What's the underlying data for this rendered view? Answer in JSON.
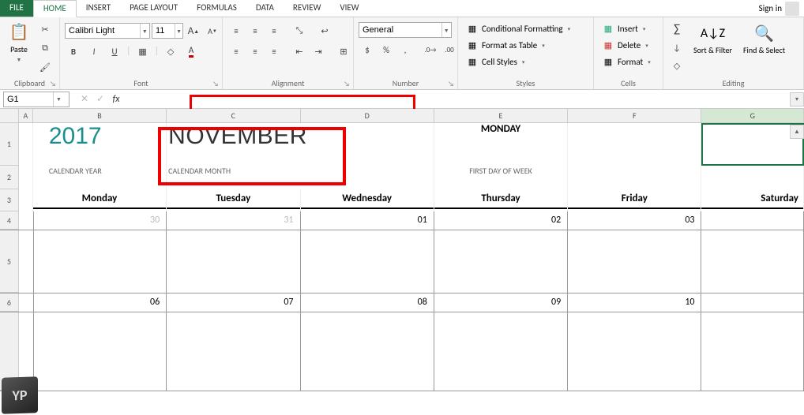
{
  "tabs": {
    "file": "FILE",
    "home": "HOME",
    "insert": "INSERT",
    "pagelayout": "PAGE LAYOUT",
    "formulas": "FORMULAS",
    "data": "DATA",
    "review": "REVIEW",
    "view": "VIEW"
  },
  "signin": "Sign in",
  "ribbon": {
    "clipboard": {
      "label": "Clipboard",
      "paste": "Paste"
    },
    "font": {
      "label": "Font",
      "name": "Calibri Light",
      "size": "11"
    },
    "alignment": {
      "label": "Alignment"
    },
    "number": {
      "label": "Number",
      "format": "General"
    },
    "styles": {
      "label": "Styles",
      "cond": "Conditional Formatting",
      "table": "Format as Table",
      "cellstyles": "Cell Styles"
    },
    "cells": {
      "label": "Cells",
      "insert": "Insert",
      "delete": "Delete",
      "format": "Format"
    },
    "editing": {
      "label": "Editing",
      "sort": "Sort & Filter",
      "find": "Find & Select"
    }
  },
  "namebox": "G1",
  "formula": "",
  "columns": {
    "A": "A",
    "B": "B",
    "C": "C",
    "D": "D",
    "E": "E",
    "F": "F",
    "G": "G"
  },
  "rownums": [
    "1",
    "2",
    "3",
    "4",
    "5",
    "6"
  ],
  "calendar": {
    "year": "2017",
    "yearlabel": "CALENDAR YEAR",
    "month": "NOVEMBER",
    "monthlabel": "CALENDAR MONTH",
    "firstday": "MONDAY",
    "firstdaylabel": "FIRST DAY OF WEEK",
    "days": [
      "Monday",
      "Tuesday",
      "Wednesday",
      "Thursday",
      "Friday",
      "Saturday"
    ],
    "week1": [
      "30",
      "31",
      "01",
      "02",
      "03",
      ""
    ],
    "week2": [
      "06",
      "07",
      "08",
      "09",
      "10",
      ""
    ]
  }
}
